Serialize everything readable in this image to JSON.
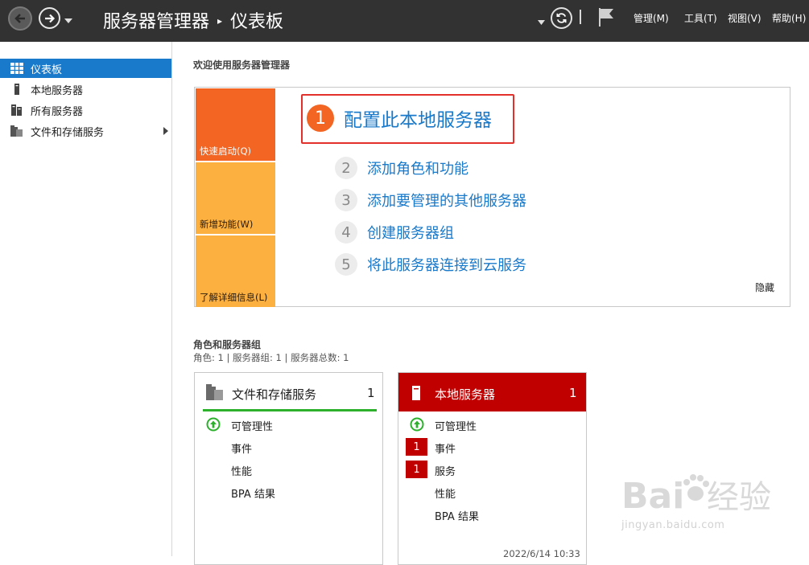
{
  "titlebar": {
    "breadcrumb": [
      "服务器管理器",
      "仪表板"
    ],
    "breadcrumb_separator": "▸",
    "menus": [
      "管理(M)",
      "工具(T)",
      "视图(V)",
      "帮助(H)"
    ]
  },
  "sidebar": {
    "items": [
      {
        "label": "仪表板",
        "icon": "dashboard-grid-icon",
        "active": true
      },
      {
        "label": "本地服务器",
        "icon": "server-icon",
        "active": false
      },
      {
        "label": "所有服务器",
        "icon": "servers-icon",
        "active": false
      },
      {
        "label": "文件和存储服务",
        "icon": "file-storage-icon",
        "active": false,
        "expandable": true
      }
    ]
  },
  "welcome": {
    "title": "欢迎使用服务器管理器",
    "tiles": [
      "快速启动(Q)",
      "新增功能(W)",
      "了解详细信息(L)"
    ],
    "steps": [
      {
        "num": "1",
        "label": "配置此本地服务器"
      },
      {
        "num": "2",
        "label": "添加角色和功能"
      },
      {
        "num": "3",
        "label": "添加要管理的其他服务器"
      },
      {
        "num": "4",
        "label": "创建服务器组"
      },
      {
        "num": "5",
        "label": "将此服务器连接到云服务"
      }
    ],
    "hide_label": "隐藏"
  },
  "roles": {
    "title": "角色和服务器组",
    "summary": "角色: 1 | 服务器组: 1 | 服务器总数: 1",
    "cards": [
      {
        "title": "文件和存储服务",
        "count": "1",
        "rows": [
          "可管理性",
          "事件",
          "性能",
          "BPA 结果"
        ]
      },
      {
        "title": "本地服务器",
        "count": "1",
        "rows": [
          "可管理性",
          "事件",
          "服务",
          "性能",
          "BPA 结果"
        ],
        "badges": [
          "1",
          "1"
        ],
        "timestamp": "2022/6/14 10:33"
      }
    ]
  },
  "watermark": {
    "brand": "Bai du 经验",
    "url": "jingyan.baidu.com"
  },
  "colors": {
    "titlebar": "#323232",
    "accent_blue": "#1979ca",
    "quick_start": "#f26522",
    "tile_orange": "#fcb040",
    "alert_red": "#c00000",
    "ok_green": "#2db12d"
  }
}
